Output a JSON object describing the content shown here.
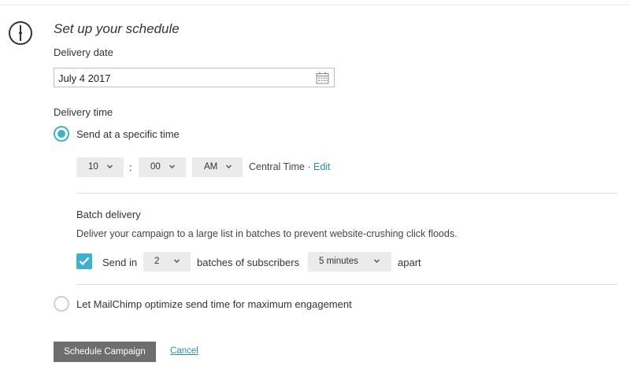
{
  "icons": {
    "clock": "clock-icon",
    "calendar": "calendar-icon",
    "chevron": "chevron-down-icon",
    "check": "checkmark-icon"
  },
  "colors": {
    "accent": "#3fb1cf",
    "link": "#2a8fa8",
    "button": "#6e6e6e"
  },
  "schedule": {
    "title": "Set up your schedule",
    "delivery_date_label": "Delivery date",
    "delivery_date_value": "July 4 2017",
    "delivery_time_label": "Delivery time",
    "specific_time_option": "Send at a specific time",
    "specific_time_selected": true,
    "hour": "10",
    "colon": ":",
    "minute": "00",
    "meridiem": "AM",
    "timezone_text": "Central Time ·",
    "timezone_edit": "Edit"
  },
  "batch": {
    "title": "Batch delivery",
    "description": "Deliver your campaign to a large list in batches to prevent website-crushing click floods.",
    "enabled": true,
    "send_in_label": "Send in",
    "batch_count": "2",
    "batches_label": "batches of subscribers",
    "interval": "5 minutes",
    "apart_label": "apart"
  },
  "optimize": {
    "option": "Let MailChimp optimize send time for maximum engagement",
    "selected": false
  },
  "actions": {
    "schedule_button": "Schedule Campaign",
    "cancel_link": "Cancel"
  }
}
